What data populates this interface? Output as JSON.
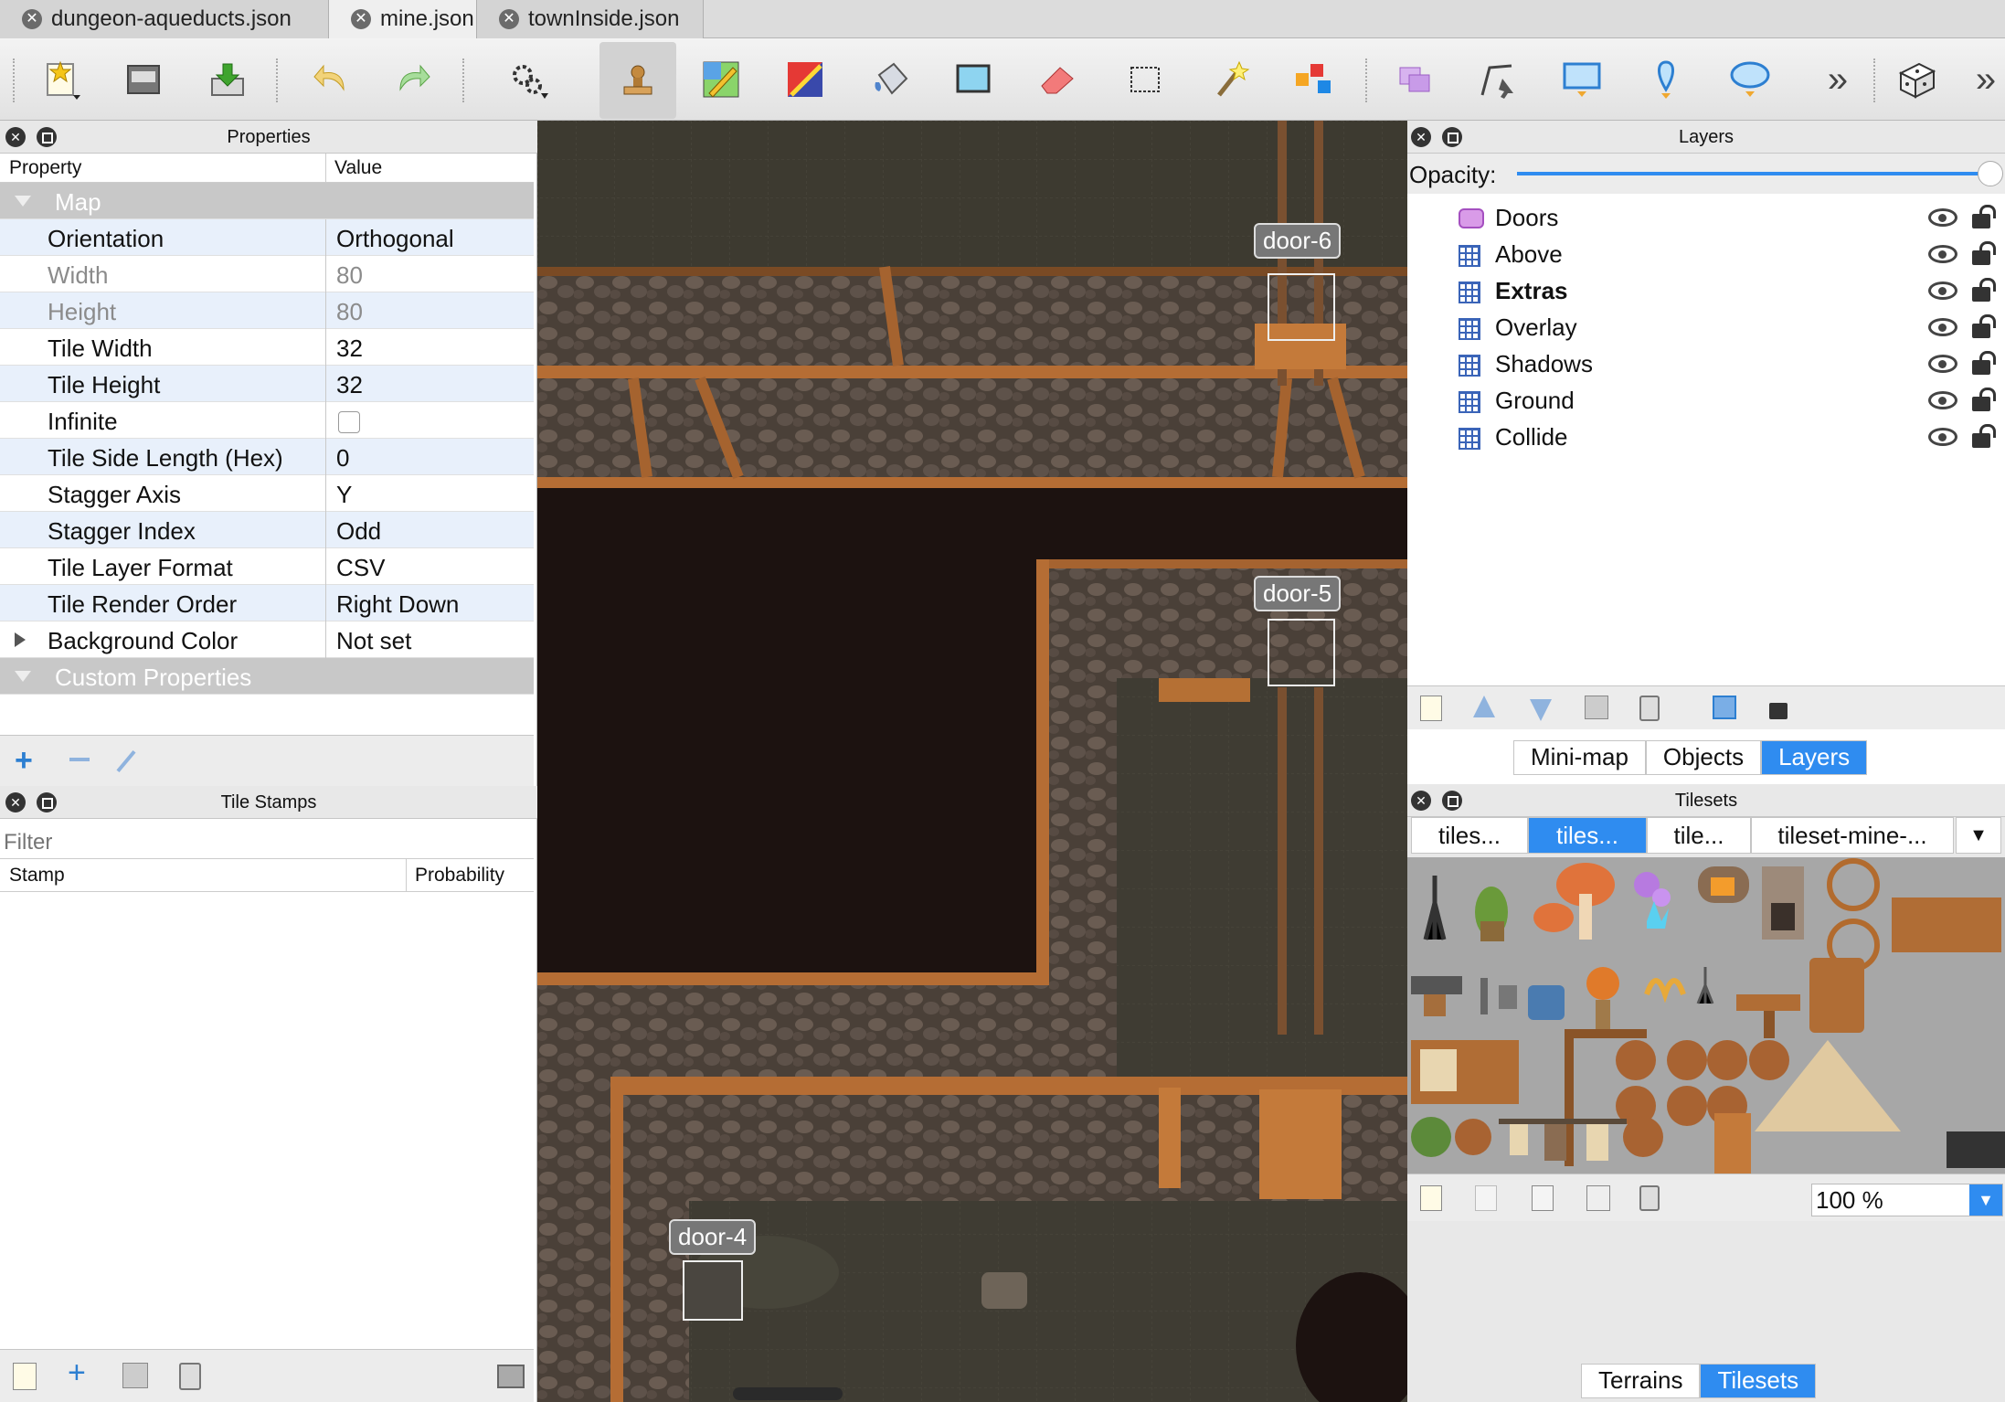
{
  "tabs": [
    {
      "label": "dungeon-aqueducts.json",
      "active": false
    },
    {
      "label": "mine.json",
      "active": true
    },
    {
      "label": "townInside.json",
      "active": false
    }
  ],
  "toolbar": {
    "icons": [
      "new-map-icon",
      "open-icon",
      "save-icon",
      "undo-icon",
      "redo-icon",
      "commands-icon",
      "stamp-brush-icon",
      "terrain-brush-icon",
      "wang-brush-icon",
      "bucket-fill-icon",
      "shape-fill-icon",
      "eraser-icon",
      "rect-select-icon",
      "magic-wand-icon",
      "select-same-tile-icon",
      "select-objects-icon",
      "edit-polygons-icon",
      "insert-rectangle-icon",
      "insert-point-icon",
      "insert-ellipse-icon",
      "more-icon",
      "random-mode-icon",
      "more-right-icon"
    ],
    "more_label": "»"
  },
  "properties": {
    "title": "Properties",
    "col_property": "Property",
    "col_value": "Value",
    "section_map": "Map",
    "rows": [
      {
        "key": "Orientation",
        "value": "Orthogonal",
        "disabled": false
      },
      {
        "key": "Width",
        "value": "80",
        "disabled": true
      },
      {
        "key": "Height",
        "value": "80",
        "disabled": true
      },
      {
        "key": "Tile Width",
        "value": "32",
        "disabled": false
      },
      {
        "key": "Tile Height",
        "value": "32",
        "disabled": false
      },
      {
        "key": "Infinite",
        "value": "",
        "disabled": false,
        "checkbox": true
      },
      {
        "key": "Tile Side Length (Hex)",
        "value": "0",
        "disabled": false
      },
      {
        "key": "Stagger Axis",
        "value": "Y",
        "disabled": false
      },
      {
        "key": "Stagger Index",
        "value": "Odd",
        "disabled": false
      },
      {
        "key": "Tile Layer Format",
        "value": "CSV",
        "disabled": false
      },
      {
        "key": "Tile Render Order",
        "value": "Right Down",
        "disabled": false
      },
      {
        "key": "Background Color",
        "value": "Not set",
        "disabled": false
      }
    ],
    "section_custom": "Custom Properties"
  },
  "stamps": {
    "title": "Tile Stamps",
    "filter_placeholder": "Filter",
    "col_stamp": "Stamp",
    "col_probability": "Probability"
  },
  "map": {
    "doors": [
      {
        "label": "door-6"
      },
      {
        "label": "door-5"
      },
      {
        "label": "door-4"
      }
    ]
  },
  "layers": {
    "title": "Layers",
    "opacity_label": "Opacity:",
    "opacity_value": 1.0,
    "items": [
      {
        "name": "Doors",
        "type": "object",
        "bold": false
      },
      {
        "name": "Above",
        "type": "tile",
        "bold": false
      },
      {
        "name": "Extras",
        "type": "tile",
        "bold": true
      },
      {
        "name": "Overlay",
        "type": "tile",
        "bold": false
      },
      {
        "name": "Shadows",
        "type": "tile",
        "bold": false
      },
      {
        "name": "Ground",
        "type": "tile",
        "bold": false
      },
      {
        "name": "Collide",
        "type": "tile",
        "bold": false
      }
    ],
    "view_tabs": [
      {
        "label": "Mini-map",
        "active": false
      },
      {
        "label": "Objects",
        "active": false
      },
      {
        "label": "Layers",
        "active": true
      }
    ]
  },
  "tilesets": {
    "title": "Tilesets",
    "tabs": [
      {
        "label": "tiles...",
        "active": false
      },
      {
        "label": "tiles...",
        "active": true
      },
      {
        "label": "tile...",
        "active": false
      },
      {
        "label": "tileset-mine-...",
        "active": false
      }
    ],
    "zoom": "100 %",
    "bottom_tabs": [
      {
        "label": "Terrains",
        "active": false
      },
      {
        "label": "Tilesets",
        "active": true
      }
    ]
  },
  "colors": {
    "accent": "#2f8cf0",
    "map_floor": "#3d3a30",
    "wood": "#b56d34",
    "void": "#1c1210"
  }
}
